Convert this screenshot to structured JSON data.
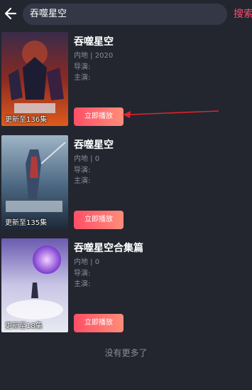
{
  "search": {
    "query": "吞噬星空",
    "button_label": "搜索"
  },
  "results": [
    {
      "title": "吞噬星空",
      "meta": "内地 | 2020",
      "director": "导演:",
      "cast": "主演:",
      "update": "更新至136集",
      "play_label": "立即播放"
    },
    {
      "title": "吞噬星空",
      "meta": "内地 | 0",
      "director": "导演:",
      "cast": "主演:",
      "update": "更新至135集",
      "play_label": "立即播放"
    },
    {
      "title": "吞噬星空合集篇",
      "meta": "内地 | 0",
      "director": "导演:",
      "cast": "主演:",
      "update": "更新至18集",
      "play_label": "立即播放"
    }
  ],
  "footer": {
    "text": "没有更多了"
  },
  "colors": {
    "background": "#23262f",
    "accent": "#ff4a6e",
    "arrow": "#e3232a"
  }
}
